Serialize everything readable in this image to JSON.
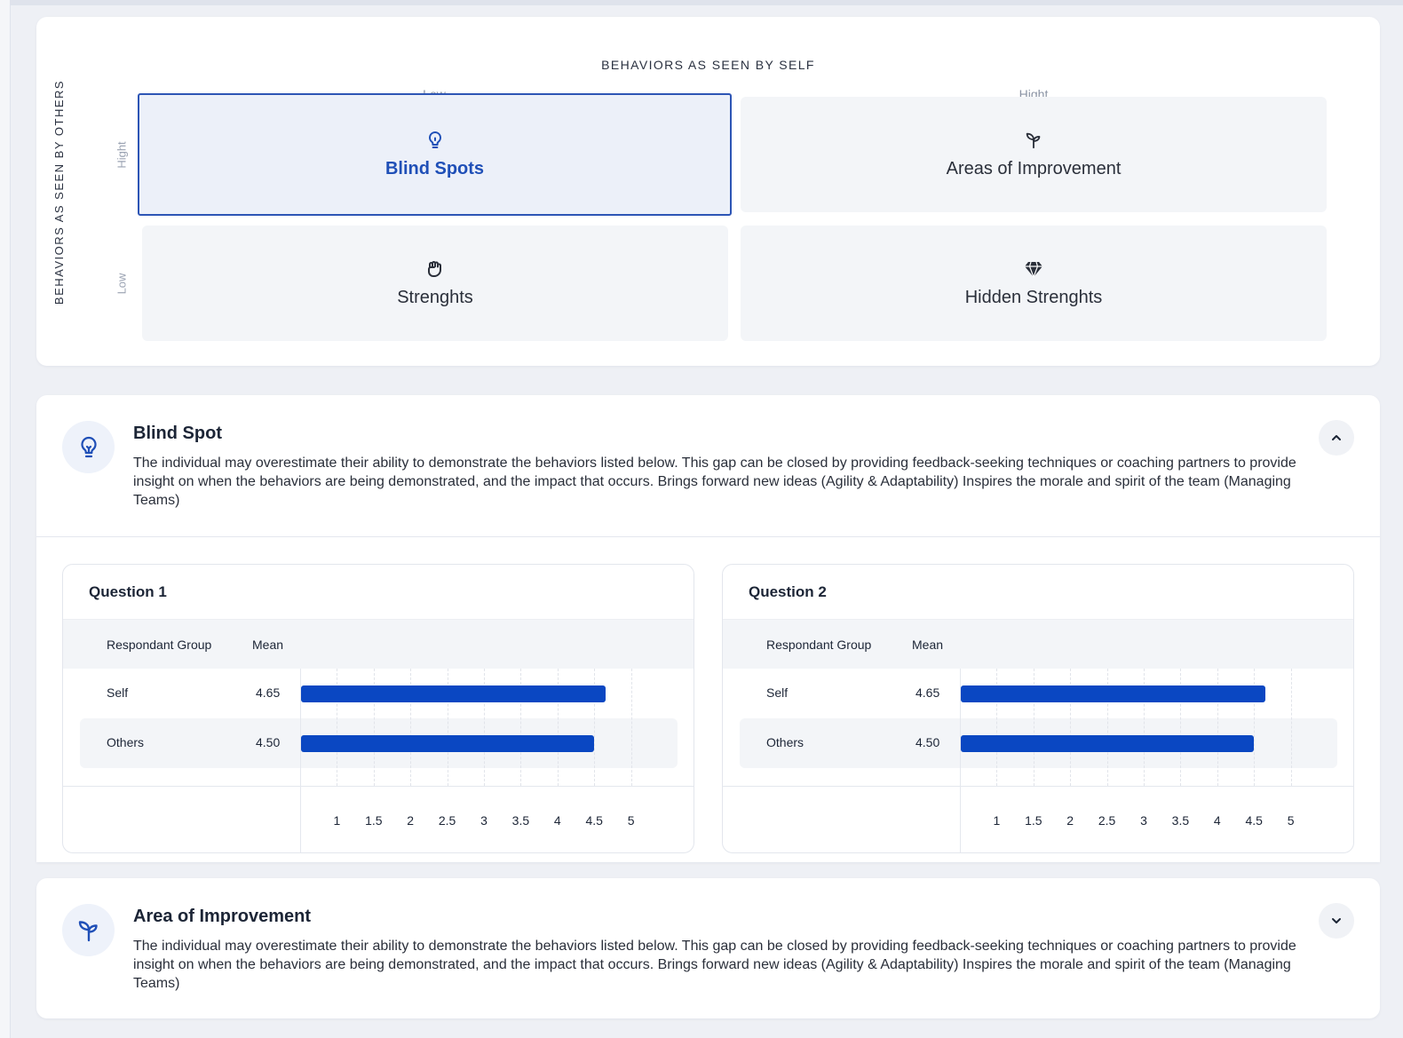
{
  "matrix": {
    "title": "BEHAVIORS AS SEEN BY SELF",
    "row_axis_title": "BEHAVIORS AS SEEN BY OTHERS",
    "col_low": "Low",
    "col_high": "Hight",
    "row_high": "Hight",
    "row_low": "Low",
    "quadrants": {
      "blind_spots": {
        "label": "Blind Spots",
        "icon": "lightbulb-icon",
        "selected": true
      },
      "areas_of_improvement": {
        "label": "Areas of Improvement",
        "icon": "sprout-icon"
      },
      "strengths": {
        "label": "Strenghts",
        "icon": "fist-icon"
      },
      "hidden_strengths": {
        "label": "Hidden Strenghts",
        "icon": "diamond-icon"
      }
    }
  },
  "blind_spot": {
    "title": "Blind Spot",
    "icon": "lightbulb-icon",
    "expanded": true,
    "description": "The individual may overestimate their ability to demonstrate the behaviors listed below.  This gap can be closed by providing feedback-seeking techniques or coaching partners to provide insight on when the behaviors are being demonstrated, and the impact that occurs. Brings forward new ideas (Agility & Adaptability) Inspires the morale and spirit of the team (Managing Teams)",
    "questions": [
      {
        "title": "Question 1",
        "col_group": "Respondant Group",
        "col_mean": "Mean",
        "rows": [
          {
            "group": "Self",
            "mean": "4.65"
          },
          {
            "group": "Others",
            "mean": "4.50"
          }
        ]
      },
      {
        "title": "Question 2",
        "col_group": "Respondant Group",
        "col_mean": "Mean",
        "rows": [
          {
            "group": "Self",
            "mean": "4.65"
          },
          {
            "group": "Others",
            "mean": "4.50"
          }
        ]
      }
    ]
  },
  "chart_data": [
    {
      "type": "bar",
      "orientation": "horizontal",
      "title": "Question 1",
      "categories": [
        "Self",
        "Others"
      ],
      "values": [
        4.65,
        4.5
      ],
      "xlim": [
        0.5,
        5.5
      ],
      "xticks": [
        "1",
        "1.5",
        "2",
        "2.5",
        "3",
        "3.5",
        "4",
        "4.5",
        "5"
      ],
      "color": "#0a47c2"
    },
    {
      "type": "bar",
      "orientation": "horizontal",
      "title": "Question 2",
      "categories": [
        "Self",
        "Others"
      ],
      "values": [
        4.65,
        4.5
      ],
      "xlim": [
        0.5,
        5.5
      ],
      "xticks": [
        "1",
        "1.5",
        "2",
        "2.5",
        "3",
        "3.5",
        "4",
        "4.5",
        "5"
      ],
      "color": "#0a47c2"
    }
  ],
  "area_of_improvement": {
    "title": "Area of Improvement",
    "icon": "sprout-icon",
    "expanded": false,
    "description": "The individual may overestimate their ability to demonstrate the behaviors listed below.  This gap can be closed by providing feedback-seeking techniques or coaching partners to provide insight on when the behaviors are being demonstrated, and the impact that occurs. Brings forward new ideas (Agility & Adaptability) Inspires the morale and spirit of the team (Managing Teams)"
  },
  "colors": {
    "accent": "#0a47c2",
    "selected_border": "#2d55b5",
    "selected_text": "#1f4fb7"
  }
}
